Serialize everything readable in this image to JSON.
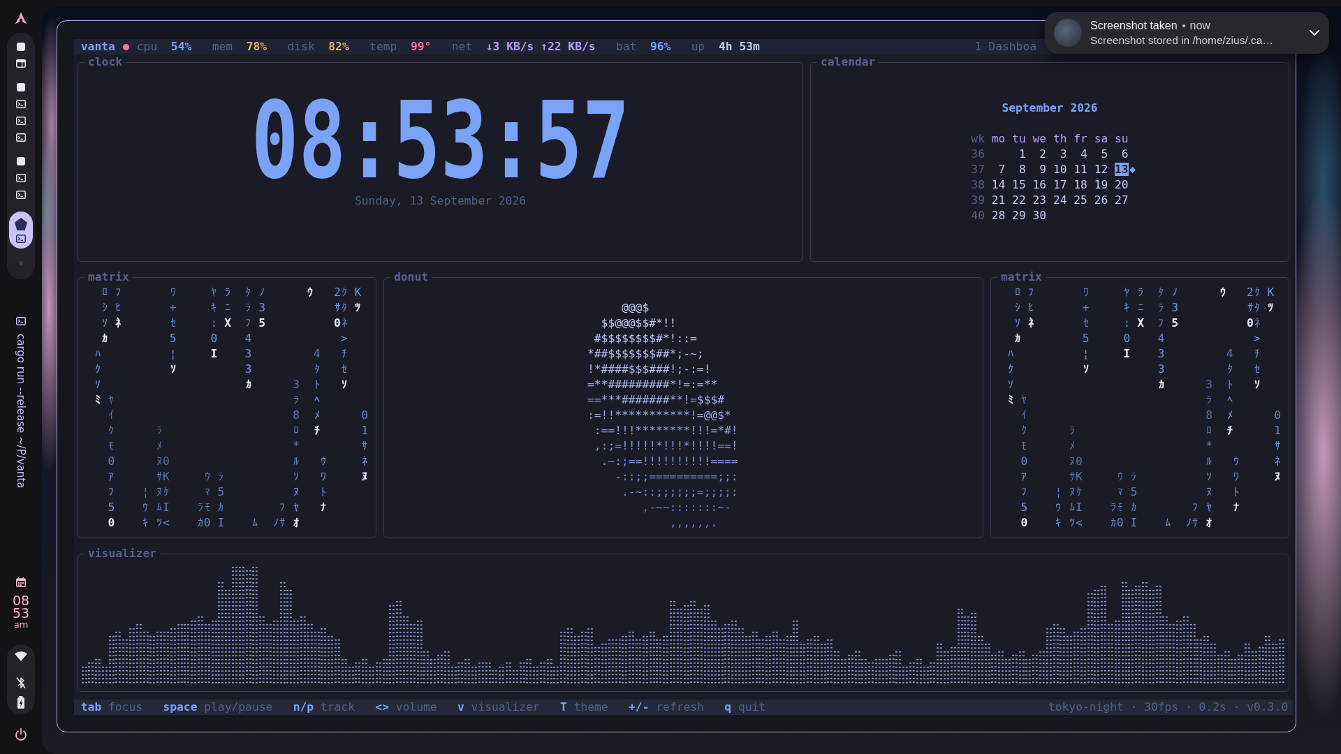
{
  "dock": {
    "workspaces": [
      {
        "selected": false,
        "windows": [
          {
            "kind": "browser"
          }
        ]
      },
      {
        "selected": false,
        "windows": [
          {
            "kind": "terminal"
          },
          {
            "kind": "terminal"
          },
          {
            "kind": "terminal"
          }
        ]
      },
      {
        "selected": false,
        "windows": [
          {
            "kind": "terminal"
          },
          {
            "kind": "terminal"
          }
        ]
      },
      {
        "selected": true,
        "windows": [
          {
            "kind": "terminal"
          }
        ]
      },
      {
        "selected": false
      }
    ],
    "active_window": {
      "title": "cargo run --release ~/P/vanta"
    },
    "clock": {
      "hour": "08",
      "minute": "53",
      "period": "am"
    },
    "tray": {
      "wifi": {
        "on": true
      },
      "bluetooth": {
        "on": false
      },
      "battery": {
        "charging": true
      }
    }
  },
  "status_bar": {
    "host": "vanta",
    "metrics": [
      {
        "label": "cpu",
        "value": "54%",
        "color": "#7aa2f7"
      },
      {
        "label": "mem",
        "value": "78%",
        "color": "#e0af68"
      },
      {
        "label": "disk",
        "value": "82%",
        "color": "#e0af68"
      },
      {
        "label": "temp",
        "value": "99°",
        "color": "#f7768e"
      },
      {
        "label": "net",
        "value": "↓3 KB/s ↑22 KB/s",
        "color": "#bb9af7"
      },
      {
        "label": "bat",
        "value": "96%",
        "color": "#7aa2f7"
      },
      {
        "label": "up",
        "value": "4h 53m",
        "color": "#c0caf5"
      }
    ],
    "workspace": "1 Dashboa"
  },
  "notification": {
    "title": "Screenshot taken",
    "time": "now",
    "body": "Screenshot stored in /home/zius/.ca…"
  },
  "clock": {
    "title": "clock",
    "time": "08:53:57",
    "date": "Sunday, 13 September 2026"
  },
  "calendar": {
    "title": "calendar",
    "month": "September 2026",
    "week_label": "wk",
    "weekdays": [
      "mo",
      "tu",
      "we",
      "th",
      "fr",
      "sa",
      "su"
    ],
    "weeks": [
      {
        "number": "36",
        "days": [
          {
            "day": "1",
            "selected": false
          },
          {
            "day": "2",
            "selected": false
          },
          {
            "day": "3",
            "selected": false
          },
          {
            "day": "4",
            "selected": false
          },
          {
            "day": "5",
            "selected": false
          },
          {
            "day": "6",
            "selected": false
          }
        ]
      },
      {
        "number": "37",
        "days": [
          {
            "day": "7",
            "selected": false
          },
          {
            "day": "8",
            "selected": false
          },
          {
            "day": "9",
            "selected": false
          },
          {
            "day": "10",
            "selected": false
          },
          {
            "day": "11",
            "selected": false
          },
          {
            "day": "12",
            "selected": false
          },
          {
            "day": "13",
            "selected": true
          }
        ]
      },
      {
        "number": "38",
        "days": [
          {
            "day": "14",
            "selected": false
          },
          {
            "day": "15",
            "selected": false
          },
          {
            "day": "16",
            "selected": false
          },
          {
            "day": "17",
            "selected": false
          },
          {
            "day": "18",
            "selected": false
          },
          {
            "day": "19",
            "selected": false
          },
          {
            "day": "20",
            "selected": false
          }
        ]
      },
      {
        "number": "39",
        "days": [
          {
            "day": "21",
            "selected": false
          },
          {
            "day": "22",
            "selected": false
          },
          {
            "day": "23",
            "selected": false
          },
          {
            "day": "24",
            "selected": false
          },
          {
            "day": "25",
            "selected": false
          },
          {
            "day": "26",
            "selected": false
          },
          {
            "day": "27",
            "selected": false
          }
        ]
      },
      {
        "number": "40",
        "days": [
          {
            "day": "28",
            "selected": false
          },
          {
            "day": "29",
            "selected": false
          },
          {
            "day": "30",
            "selected": false
          }
        ]
      }
    ]
  },
  "middle_row": [
    {
      "kind": "matrix",
      "title": "matrix",
      "lines": [
        [
          {
            "text": " ﾛ",
            "head": false
          },
          {
            "text": " ﾌ",
            "head": false
          },
          {
            "text": "       ﾜ",
            "head": false
          },
          {
            "text": "     ﾔ",
            "head": false
          },
          {
            "text": " ﾗ",
            "head": false
          },
          {
            "text": "  ﾀ",
            "head": false
          },
          {
            "text": " ﾉ",
            "head": false
          },
          {
            "text": "      ｳ",
            "head": true
          },
          {
            "text": "   2ｸ",
            "head": false
          },
          {
            "text": " K",
            "head": false
          }
        ],
        [
          {
            "text": " ｼ",
            "head": false
          },
          {
            "text": " ﾋ",
            "head": false
          },
          {
            "text": "       +",
            "head": false
          },
          {
            "text": "     ｷ",
            "head": false
          },
          {
            "text": " ﾆ",
            "head": false
          },
          {
            "text": "  ﾗ",
            "head": false
          },
          {
            "text": " 3",
            "head": false
          },
          {
            "text": "          ｻﾀ",
            "head": false
          },
          {
            "text": " ﾂ",
            "head": true
          }
        ],
        [
          {
            "text": " ｿ",
            "head": false
          },
          {
            "text": " ﾈ",
            "head": true
          },
          {
            "text": "       ｾ",
            "head": false
          },
          {
            "text": "     :",
            "head": false
          },
          {
            "text": " X",
            "head": true
          },
          {
            "text": "  ﾌ",
            "head": false
          },
          {
            "text": " 5",
            "head": true
          },
          {
            "text": "          0",
            "head": true
          },
          {
            "text": "ﾈ",
            "head": false
          }
        ],
        [
          {
            "text": " ｶ",
            "head": true
          },
          {
            "text": "         5",
            "head": false
          },
          {
            "text": "     0",
            "head": false
          },
          {
            "text": "    4",
            "head": false
          },
          {
            "text": "             >",
            "head": false
          }
        ],
        [
          {
            "text": "ﾊ",
            "head": false
          },
          {
            "text": "          ¦",
            "head": false
          },
          {
            "text": "     I",
            "head": true
          },
          {
            "text": "    3",
            "head": false
          },
          {
            "text": "         4",
            "head": false
          },
          {
            "text": "   ﾁ",
            "head": false
          }
        ],
        [
          {
            "text": "ｸ",
            "head": false
          },
          {
            "text": "          ｿ",
            "head": true
          },
          {
            "text": "          3",
            "head": false
          },
          {
            "text": "         ﾀ",
            "head": false
          },
          {
            "text": "   ｾ",
            "head": false
          }
        ],
        [
          {
            "text": "ｿ",
            "head": false
          },
          {
            "text": "                     ｶ",
            "head": true
          },
          {
            "text": "      3",
            "head": false
          },
          {
            "text": "  ﾄ",
            "head": false
          },
          {
            "text": "   ｿ",
            "head": true
          }
        ],
        [
          {
            "text": "ﾐ",
            "head": true
          },
          {
            "text": " ﾔ",
            "head": false
          },
          {
            "text": "                          ﾗ",
            "head": false
          },
          {
            "text": "  ﾍ",
            "head": false
          }
        ],
        [
          {
            "text": "  ｲ",
            "head": false
          },
          {
            "text": "                          8",
            "head": false
          },
          {
            "text": "  ﾒ",
            "head": false
          },
          {
            "text": "      0",
            "head": false
          }
        ],
        [
          {
            "text": "  ｸ",
            "head": false
          },
          {
            "text": "      ﾗ",
            "head": false
          },
          {
            "text": "                   ﾛ",
            "head": false
          },
          {
            "text": "  ﾁ",
            "head": true
          },
          {
            "text": "      1",
            "head": false
          }
        ],
        [
          {
            "text": "  ﾓ",
            "head": false
          },
          {
            "text": "      ﾒ",
            "head": false
          },
          {
            "text": "                   *",
            "head": false
          },
          {
            "text": "         ｻ",
            "head": false
          }
        ],
        [
          {
            "text": "  0",
            "head": false
          },
          {
            "text": "      ﾇ0",
            "head": false
          },
          {
            "text": "                  ﾙ",
            "head": false
          },
          {
            "text": "   ｳ",
            "head": false
          },
          {
            "text": "     ﾈ",
            "head": false
          }
        ],
        [
          {
            "text": "  ｱ",
            "head": false
          },
          {
            "text": "      ｻK",
            "head": false
          },
          {
            "text": "     ｳ",
            "head": false
          },
          {
            "text": " ﾗ",
            "head": false
          },
          {
            "text": "          ｿ",
            "head": false
          },
          {
            "text": "   ﾜ",
            "head": false
          },
          {
            "text": "     ﾇ",
            "head": true
          }
        ],
        [
          {
            "text": "  ﾌ",
            "head": false
          },
          {
            "text": "    ¦",
            "head": false
          },
          {
            "text": " ﾇｹ",
            "head": false
          },
          {
            "text": "     ﾏ",
            "head": false
          },
          {
            "text": " 5",
            "head": false
          },
          {
            "text": "          ﾇ",
            "head": false
          },
          {
            "text": "   ﾄ",
            "head": false
          }
        ],
        [
          {
            "text": "  5",
            "head": false
          },
          {
            "text": "    ｳ",
            "head": false
          },
          {
            "text": " ﾑI",
            "head": false
          },
          {
            "text": "    ﾗﾓ",
            "head": false
          },
          {
            "text": " ｶ",
            "head": false
          },
          {
            "text": "        ﾌ",
            "head": false
          },
          {
            "text": " ﾔ",
            "head": false
          },
          {
            "text": "   ﾅ",
            "head": true
          }
        ],
        [
          {
            "text": "  0",
            "head": true
          },
          {
            "text": "    ｷ",
            "head": false
          },
          {
            "text": " ﾂ<",
            "head": false
          },
          {
            "text": "    ｶ0",
            "head": false
          },
          {
            "text": " I",
            "head": false
          },
          {
            "text": "    ﾑ",
            "head": false
          },
          {
            "text": "  ﾉｻ",
            "head": false
          },
          {
            "text": " ｵ",
            "head": true
          }
        ]
      ]
    },
    {
      "kind": "donut",
      "title": "donut",
      "lines": [
        "     @@@$",
        "  $$@@@$$#*!!",
        " #$$$$$$$$#*!::=",
        "*##$$$$$$$##*;-~;",
        "!*####$$$###!;-:=!",
        "=**#########*!=:=**",
        "==***#######**!=$$$#",
        ":=!!***********!=@@$*",
        " :==!!!********!!!=*#!",
        " ,:;=!!!!!*!!!*!!!!==!",
        "  .~:;==!!!!!!!!!!====",
        "    -::;;==========;;:",
        "     .-~::;;;;;;=;;;;:",
        "        ,-~~:::::::~-",
        "            ,,,,,,."
      ]
    },
    {
      "kind": "matrix",
      "title": "matrix",
      "lines": [
        [
          {
            "text": " ﾛ",
            "head": false
          },
          {
            "text": " ﾌ",
            "head": false
          },
          {
            "text": "       ﾜ",
            "head": false
          },
          {
            "text": "     ﾔ",
            "head": false
          },
          {
            "text": " ﾗ",
            "head": false
          },
          {
            "text": "  ﾀ",
            "head": false
          },
          {
            "text": " ﾉ",
            "head": false
          },
          {
            "text": "      ｳ",
            "head": true
          },
          {
            "text": "   2ｸ",
            "head": false
          },
          {
            "text": " K",
            "head": false
          }
        ],
        [
          {
            "text": " ｼ",
            "head": false
          },
          {
            "text": " ﾋ",
            "head": false
          },
          {
            "text": "       +",
            "head": false
          },
          {
            "text": "     ｷ",
            "head": false
          },
          {
            "text": " ﾆ",
            "head": false
          },
          {
            "text": "  ﾗ",
            "head": false
          },
          {
            "text": " 3",
            "head": false
          },
          {
            "text": "          ｻﾀ",
            "head": false
          },
          {
            "text": " ﾂ",
            "head": true
          }
        ],
        [
          {
            "text": " ｿ",
            "head": false
          },
          {
            "text": " ﾈ",
            "head": true
          },
          {
            "text": "       ｾ",
            "head": false
          },
          {
            "text": "     :",
            "head": false
          },
          {
            "text": " X",
            "head": true
          },
          {
            "text": "  ﾌ",
            "head": false
          },
          {
            "text": " 5",
            "head": true
          },
          {
            "text": "          0",
            "head": true
          },
          {
            "text": "ﾈ",
            "head": false
          }
        ],
        [
          {
            "text": " ｶ",
            "head": true
          },
          {
            "text": "         5",
            "head": false
          },
          {
            "text": "     0",
            "head": false
          },
          {
            "text": "    4",
            "head": false
          },
          {
            "text": "             >",
            "head": false
          }
        ],
        [
          {
            "text": "ﾊ",
            "head": false
          },
          {
            "text": "          ¦",
            "head": false
          },
          {
            "text": "     I",
            "head": true
          },
          {
            "text": "    3",
            "head": false
          },
          {
            "text": "         4",
            "head": false
          },
          {
            "text": "   ﾁ",
            "head": false
          }
        ],
        [
          {
            "text": "ｸ",
            "head": false
          },
          {
            "text": "          ｿ",
            "head": true
          },
          {
            "text": "          3",
            "head": false
          },
          {
            "text": "         ﾀ",
            "head": false
          },
          {
            "text": "   ｾ",
            "head": false
          }
        ],
        [
          {
            "text": "ｿ",
            "head": false
          },
          {
            "text": "                     ｶ",
            "head": true
          },
          {
            "text": "      3",
            "head": false
          },
          {
            "text": "  ﾄ",
            "head": false
          },
          {
            "text": "   ｿ",
            "head": true
          }
        ],
        [
          {
            "text": "ﾐ",
            "head": true
          },
          {
            "text": " ﾔ",
            "head": false
          },
          {
            "text": "                          ﾗ",
            "head": false
          },
          {
            "text": "  ﾍ",
            "head": false
          }
        ],
        [
          {
            "text": "  ｲ",
            "head": false
          },
          {
            "text": "                          8",
            "head": false
          },
          {
            "text": "  ﾒ",
            "head": false
          },
          {
            "text": "      0",
            "head": false
          }
        ],
        [
          {
            "text": "  ｸ",
            "head": false
          },
          {
            "text": "      ﾗ",
            "head": false
          },
          {
            "text": "                   ﾛ",
            "head": false
          },
          {
            "text": "  ﾁ",
            "head": true
          },
          {
            "text": "      1",
            "head": false
          }
        ],
        [
          {
            "text": "  ﾓ",
            "head": false
          },
          {
            "text": "      ﾒ",
            "head": false
          },
          {
            "text": "                   *",
            "head": false
          },
          {
            "text": "         ｻ",
            "head": false
          }
        ],
        [
          {
            "text": "  0",
            "head": false
          },
          {
            "text": "      ﾇ0",
            "head": false
          },
          {
            "text": "                  ﾙ",
            "head": false
          },
          {
            "text": "   ｳ",
            "head": false
          },
          {
            "text": "     ﾈ",
            "head": false
          }
        ],
        [
          {
            "text": "  ｱ",
            "head": false
          },
          {
            "text": "      ｻK",
            "head": false
          },
          {
            "text": "     ｳ",
            "head": false
          },
          {
            "text": " ﾗ",
            "head": false
          },
          {
            "text": "          ｿ",
            "head": false
          },
          {
            "text": "   ﾜ",
            "head": false
          },
          {
            "text": "     ﾇ",
            "head": true
          }
        ],
        [
          {
            "text": "  ﾌ",
            "head": false
          },
          {
            "text": "    ¦",
            "head": false
          },
          {
            "text": " ﾇｹ",
            "head": false
          },
          {
            "text": "     ﾏ",
            "head": false
          },
          {
            "text": " 5",
            "head": false
          },
          {
            "text": "          ﾇ",
            "head": false
          },
          {
            "text": "   ﾄ",
            "head": false
          }
        ],
        [
          {
            "text": "  5",
            "head": false
          },
          {
            "text": "    ｳ",
            "head": false
          },
          {
            "text": " ﾑI",
            "head": false
          },
          {
            "text": "    ﾗﾓ",
            "head": false
          },
          {
            "text": " ｶ",
            "head": false
          },
          {
            "text": "        ﾌ",
            "head": false
          },
          {
            "text": " ﾔ",
            "head": false
          },
          {
            "text": "   ﾅ",
            "head": true
          }
        ],
        [
          {
            "text": "  0",
            "head": true
          },
          {
            "text": "    ｷ",
            "head": false
          },
          {
            "text": " ﾂ<",
            "head": false
          },
          {
            "text": "    ｶ0",
            "head": false
          },
          {
            "text": " I",
            "head": false
          },
          {
            "text": "    ﾑ",
            "head": false
          },
          {
            "text": "  ﾉｻ",
            "head": false
          },
          {
            "text": " ｵ",
            "head": true
          }
        ]
      ]
    }
  ],
  "visualizer": {
    "title": "visualizer"
  },
  "key_hints": [
    {
      "key": "tab",
      "action": "focus"
    },
    {
      "key": "space",
      "action": "play/pause"
    },
    {
      "key": "n/p",
      "action": "track"
    },
    {
      "key": "<>",
      "action": "volume"
    },
    {
      "key": "v",
      "action": "visualizer"
    },
    {
      "key": "T",
      "action": "theme"
    },
    {
      "key": "+/-",
      "action": "refresh"
    },
    {
      "key": "q",
      "action": "quit"
    }
  ],
  "footer_info": "tokyo-night · 30fps · 0.2s · v0.3.0"
}
